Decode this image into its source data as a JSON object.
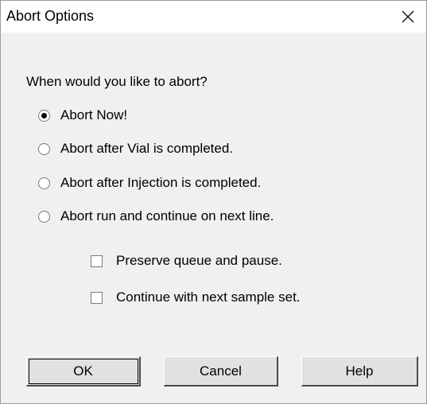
{
  "dialog": {
    "title": "Abort Options",
    "close_icon": "close-icon"
  },
  "question": "When would you like to abort?",
  "options": [
    {
      "label": "Abort Now!",
      "checked": true
    },
    {
      "label": "Abort after Vial is completed.",
      "checked": false
    },
    {
      "label": "Abort after Injection is completed.",
      "checked": false
    },
    {
      "label": "Abort run and continue on next line.",
      "checked": false
    }
  ],
  "checkboxes": [
    {
      "label": "Preserve queue and pause.",
      "checked": false
    },
    {
      "label": "Continue with next sample set.",
      "checked": false
    }
  ],
  "buttons": {
    "ok": "OK",
    "cancel": "Cancel",
    "help": "Help"
  }
}
